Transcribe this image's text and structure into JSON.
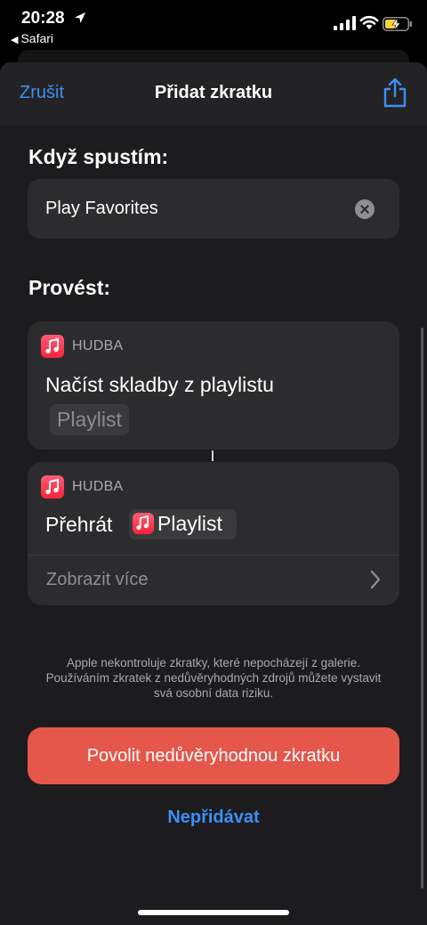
{
  "status_bar": {
    "time": "20:28",
    "back_app": "Safari"
  },
  "nav": {
    "cancel_label": "Zrušit",
    "title": "Přidat zkratku",
    "share_icon": "share-icon"
  },
  "trigger": {
    "heading": "Když spustím:",
    "phrase": "Play Favorites"
  },
  "actions": {
    "heading": "Provést:",
    "items": [
      {
        "app": "HUDBA",
        "title": "Načíst skladby z playlistu",
        "parameter": "Playlist"
      },
      {
        "app": "HUDBA",
        "title": "Přehrát",
        "parameter": "Playlist",
        "more_label": "Zobrazit více"
      }
    ]
  },
  "disclaimer": "Apple nekontroluje zkratky, které nepocházejí z galerie. Používáním zkratek z nedůvěryhodných zdrojů můžete vystavit svá osobní data riziku.",
  "buttons": {
    "allow": "Povolit nedůvěryhodnou zkratku",
    "dont_add": "Nepřidávat"
  },
  "colors": {
    "accent": "#3d8ef7",
    "danger_button": "#e5574b",
    "music": "#fa233b"
  }
}
